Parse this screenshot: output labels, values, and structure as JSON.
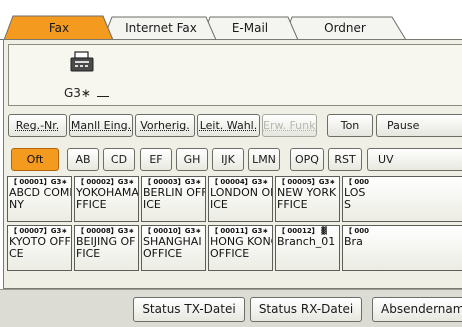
{
  "tabs": [
    {
      "label": "Fax",
      "active": true
    },
    {
      "label": "Internet Fax",
      "active": false
    },
    {
      "label": "E-Mail",
      "active": false
    },
    {
      "label": "Ordner",
      "active": false
    }
  ],
  "destination": {
    "line_mode": "G3∗",
    "icon": "fax-machine-icon"
  },
  "function_buttons": [
    {
      "label": "Reg.-Nr.",
      "disabled": false
    },
    {
      "label": "Manll Eing.",
      "disabled": false
    },
    {
      "label": "Vorherig.",
      "disabled": false
    },
    {
      "label": "Leit. Wahl.",
      "disabled": false
    },
    {
      "label": "Erw. Funkt.",
      "disabled": true
    },
    {
      "label": "Ton",
      "disabled": false
    },
    {
      "label": "Pause",
      "disabled": false
    }
  ],
  "index_tabs": [
    {
      "label": "Oft",
      "active": true
    },
    {
      "label": "AB",
      "active": false
    },
    {
      "label": "CD",
      "active": false
    },
    {
      "label": "EF",
      "active": false
    },
    {
      "label": "GH",
      "active": false
    },
    {
      "label": "IJK",
      "active": false
    },
    {
      "label": "LMN",
      "active": false
    },
    {
      "label": "OPQ",
      "active": false
    },
    {
      "label": "RST",
      "active": false
    },
    {
      "label": "UV",
      "active": false
    }
  ],
  "entries": [
    {
      "number": "【 00001】G3∗",
      "name": "ABCD COMPA\nNY"
    },
    {
      "number": "【 00002】G3∗",
      "name": "YOKOHAMA O\nFFICE"
    },
    {
      "number": "【 00003】G3∗",
      "name": "BERLIN OFF\nICE"
    },
    {
      "number": "【 00004】G3∗",
      "name": "LONDON OFF\nICE"
    },
    {
      "number": "【 00005】G3∗",
      "name": "NEW YORK O\nFFICE"
    },
    {
      "number": "【 000",
      "name": "LOS\nS"
    },
    {
      "number": "【 00007】G3∗",
      "name": "KYOTO OFFI\nCE"
    },
    {
      "number": "【 00008】G3∗",
      "name": "BEIJING OF\nFICE"
    },
    {
      "number": "【 00010】G3∗",
      "name": "SHANGHAI\nOFFICE"
    },
    {
      "number": "【 00011】G3∗",
      "name": "HONG KONG\nOFFICE"
    },
    {
      "number": "【 00012】 ▓",
      "name": "Branch_01"
    },
    {
      "number": "【 000",
      "name": "Bra"
    }
  ],
  "bottom_buttons": [
    {
      "label": "Status TX-Datei"
    },
    {
      "label": "Status RX-Datei"
    },
    {
      "label": "Absendernam"
    }
  ],
  "colors": {
    "active_tab": "#f49a1e",
    "panel_bg": "#efefe6"
  }
}
